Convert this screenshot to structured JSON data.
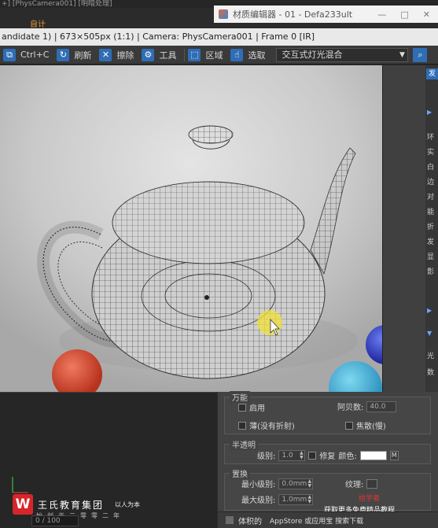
{
  "top_strip": {
    "text": "+] [PhysCamera001] [明暗处理]"
  },
  "orange_tag": "自计",
  "material_editor": {
    "title": "材质编辑器 - 01 - Defa233ult",
    "controls": [
      "—",
      "□",
      "✕"
    ]
  },
  "info_bar": {
    "text": "andidate 1) | 673×505px (1:1) | Camera: PhysCamera001 | Frame 0 [IR]"
  },
  "toolbar": {
    "copy_label": "Ctrl+C",
    "refresh_label": "刷新",
    "erase_label": "擦除",
    "tools_label": "工具",
    "region_label": "区域",
    "select_label": "选取",
    "mode_value": "交互式灯光混合"
  },
  "side_panel": {
    "tab_label": "发",
    "glyphs": [
      "环",
      "实",
      "白",
      "边",
      "对",
      "能",
      "折",
      "发",
      "显",
      "影",
      "光",
      "数"
    ]
  },
  "mat_panel": {
    "group1": {
      "title": "万能",
      "enable_label": "启用",
      "abbe_label": "阿贝数:",
      "abbe_value": "40.0",
      "thin_label": "薄(没有折射)",
      "caustics_label": "焦散(慢)"
    },
    "group2": {
      "title": "半透明",
      "level_label": "级别:",
      "level_value": "1.0",
      "correct_label": "修复",
      "color_label": "颜色:",
      "map_btn": "M"
    },
    "group3": {
      "title": "置换",
      "min_level_label": "最小级别:",
      "min_level_value": "0.0mm",
      "texture_label": "纹理:",
      "max_level_label": "最大级别:",
      "max_level_value": "1.0mm"
    }
  },
  "brand": {
    "logo": "W",
    "name": "王氏教育集团",
    "sub": "以人为本",
    "tagline": "始创于二零零二年"
  },
  "frame_counter": "0 / 100",
  "watermark": {
    "line1": "给学者",
    "line2": "获取更多免费精品教程",
    "line3": "AppStore 或应用宝 搜索下载"
  },
  "sys_bar": {
    "label": "体积的"
  }
}
